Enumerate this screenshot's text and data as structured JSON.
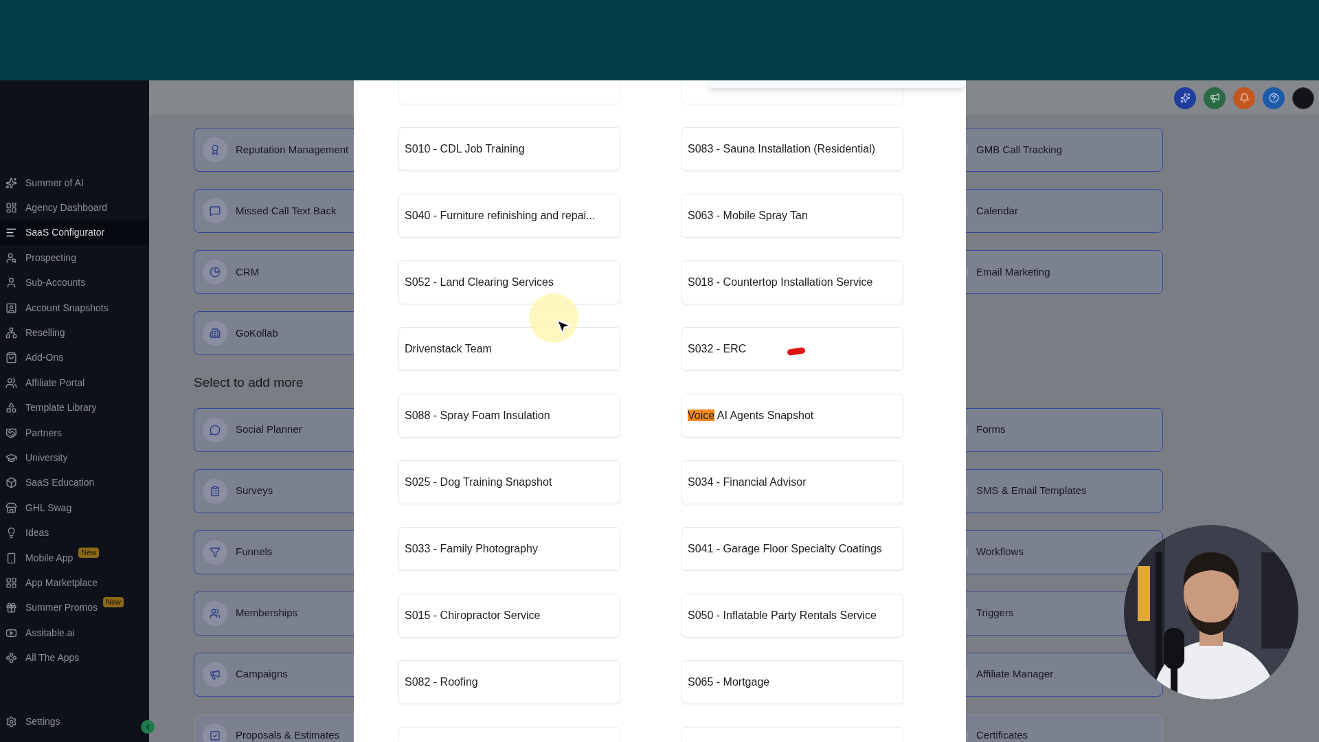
{
  "sidebar": {
    "items": [
      {
        "label": "Summer of AI",
        "selected": false
      },
      {
        "label": "Agency Dashboard",
        "selected": false
      },
      {
        "label": "SaaS Configurator",
        "selected": true
      },
      {
        "label": "Prospecting",
        "selected": false
      },
      {
        "label": "Sub-Accounts",
        "selected": false
      },
      {
        "label": "Account Snapshots",
        "selected": false
      },
      {
        "label": "Reselling",
        "selected": false
      },
      {
        "label": "Add-Ons",
        "selected": false
      },
      {
        "label": "Affiliate Portal",
        "selected": false
      },
      {
        "label": "Template Library",
        "selected": false
      },
      {
        "label": "Partners",
        "selected": false
      },
      {
        "label": "University",
        "selected": false
      },
      {
        "label": "SaaS Education",
        "selected": false
      },
      {
        "label": "GHL Swag",
        "selected": false
      },
      {
        "label": "Ideas",
        "selected": false
      },
      {
        "label": "Mobile App",
        "selected": false,
        "badge": "New"
      },
      {
        "label": "App Marketplace",
        "selected": false
      },
      {
        "label": "Summer Promos",
        "selected": false,
        "badge": "New"
      },
      {
        "label": "Assitable.ai",
        "selected": false
      },
      {
        "label": "All The Apps",
        "selected": false
      }
    ],
    "settings": "Settings"
  },
  "features": {
    "left": [
      "Reputation Management",
      "Missed Call Text Back",
      "CRM",
      "GoKollab"
    ],
    "right": [
      "GMB Call Tracking",
      "Calendar",
      "Email Marketing"
    ]
  },
  "more_heading": "Select to add more",
  "more_features": {
    "left": [
      "Social Planner",
      "Surveys",
      "Funnels",
      "Memberships",
      "Campaigns",
      "Proposals & Estimates"
    ],
    "right": [
      "Forms",
      "SMS & Email Templates",
      "Workflows",
      "Triggers",
      "Affiliate Manager",
      "Certificates"
    ]
  },
  "modal": {
    "cards": [
      {
        "kind": "plain",
        "label": "S010 - CDL Job Training"
      },
      {
        "kind": "plain",
        "label": "S083 - Sauna Installation (Residential)"
      },
      {
        "kind": "plain",
        "label": "S040 - Furniture refinishing and repai..."
      },
      {
        "kind": "plain",
        "label": "S063 - Mobile Spray Tan"
      },
      {
        "kind": "plain",
        "label": "S052 - Land Clearing Services"
      },
      {
        "kind": "plain",
        "label": "S018 - Countertop Installation Service"
      },
      {
        "kind": "plain",
        "label": "Drivenstack Team"
      },
      {
        "kind": "plain",
        "label": "S032 - ERC"
      },
      {
        "kind": "plain",
        "label": "S088 - Spray Foam Insulation"
      },
      {
        "kind": "parts",
        "parts": [
          {
            "text": "Voice",
            "highlighted": true
          },
          {
            "text": "AI Agents Snapshot",
            "highlighted": false
          }
        ]
      },
      {
        "kind": "plain",
        "label": "S025 - Dog Training Snapshot"
      },
      {
        "kind": "plain",
        "label": "S034 - Financial Advisor"
      },
      {
        "kind": "plain",
        "label": "S033 - Family Photography"
      },
      {
        "kind": "plain",
        "label": "S041 - Garage Floor Specialty Coatings"
      },
      {
        "kind": "plain",
        "label": "S015 - Chiropractor Service"
      },
      {
        "kind": "plain",
        "label": "S050 - Inflatable Party Rentals Service"
      },
      {
        "kind": "plain",
        "label": "S082 - Roofing"
      },
      {
        "kind": "plain",
        "label": "S065 - Mortgage"
      }
    ]
  }
}
